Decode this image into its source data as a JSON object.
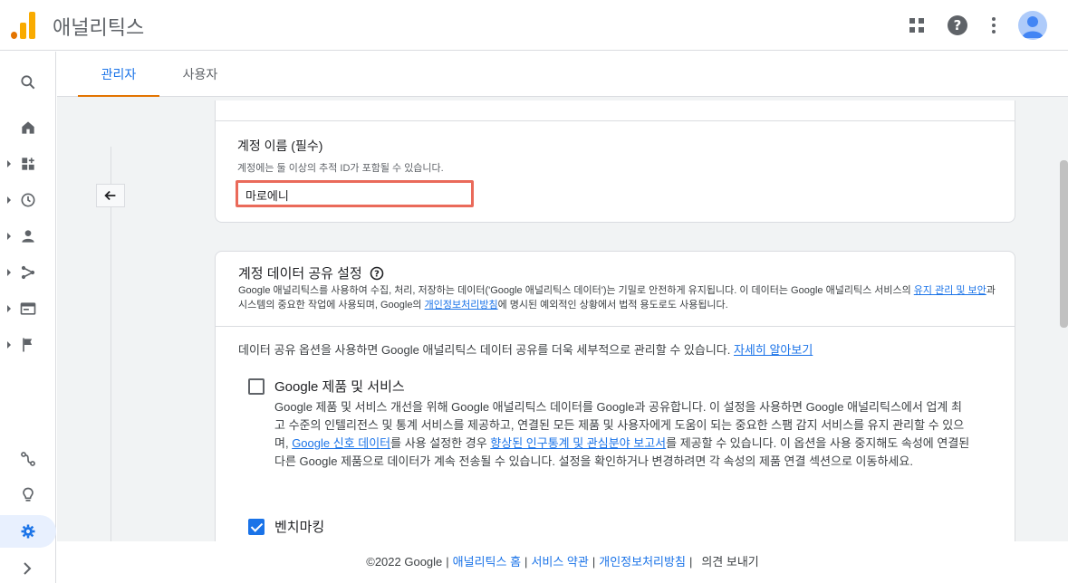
{
  "header": {
    "app_title": "애널리틱스",
    "colors": {
      "logo_orange": "#f9ab00",
      "logo_dark_orange": "#e37400",
      "accent": "#1a73e8"
    }
  },
  "rail": {
    "items": [
      {
        "icon": "search-icon"
      },
      {
        "icon": "home-icon"
      },
      {
        "icon": "dashboard-icon"
      },
      {
        "icon": "clock-icon"
      },
      {
        "icon": "person-icon"
      },
      {
        "icon": "fork-icon"
      },
      {
        "icon": "browser-window-icon"
      },
      {
        "icon": "flag-icon"
      },
      {
        "icon": "attribution-icon"
      },
      {
        "icon": "lightbulb-icon"
      },
      {
        "icon": "gear-icon"
      }
    ]
  },
  "tabs": [
    {
      "label": "관리자"
    },
    {
      "label": "사용자"
    }
  ],
  "account_name": {
    "label": "계정 이름 (필수)",
    "hint": "계정에는 둘 이상의 추적 ID가 포함될 수 있습니다.",
    "value": "마로에니"
  },
  "sharing": {
    "title": "계정 데이터 공유 설정",
    "desc_1": "Google 애널리틱스를 사용하여 수집, 처리, 저장하는 데이터('Google 애널리틱스 데이터')는 기밀로 안전하게 유지됩니다. 이 데이터는 Google 애널리틱스 서비스의 ",
    "desc_link_1": "유지 관리 및 보안",
    "desc_2": "과 시스템의 중요한 작업에 사용되며, Google의 ",
    "desc_link_2": "개인정보처리방침",
    "desc_3": "에 명시된 예외적인 상황에서 법적 용도로도 사용됩니다.",
    "intro": "데이터 공유 옵션을 사용하면 Google 애널리틱스 데이터 공유를 더욱 세부적으로 관리할 수 있습니다. ",
    "intro_link": "자세히 알아보기",
    "options": [
      {
        "title": "Google 제품 및 서비스",
        "checked": false,
        "desc_1": "Google 제품 및 서비스 개선을 위해 Google 애널리틱스 데이터를 Google과 공유합니다. 이 설정을 사용하면 Google 애널리틱스에서 업계 최고 수준의 인텔리전스 및 통계 서비스를 제공하고, 연결된 모든 제품 및 사용자에게 도움이 되는 중요한 스팸 감지 서비스를 유지 관리할 수 있으며, ",
        "link_1": "Google 신호 데이터",
        "desc_2": "를 사용 설정한 경우 ",
        "link_2": "향상된 인구통계 및 관심분야 보고서",
        "desc_3": "를 제공할 수 있습니다. 이 옵션을 사용 중지해도 속성에 연결된 다른 Google 제품으로 데이터가 계속 전송될 수 있습니다. 설정을 확인하거나 변경하려면 각 속성의 제품 연결 섹션으로 이동하세요."
      },
      {
        "title": "벤치마킹",
        "checked": true
      }
    ]
  },
  "footer": {
    "copyright": "©2022 Google",
    "links": [
      "애널리틱스 홈",
      "서비스 약관",
      "개인정보처리방침"
    ],
    "feedback": "의견 보내기"
  }
}
